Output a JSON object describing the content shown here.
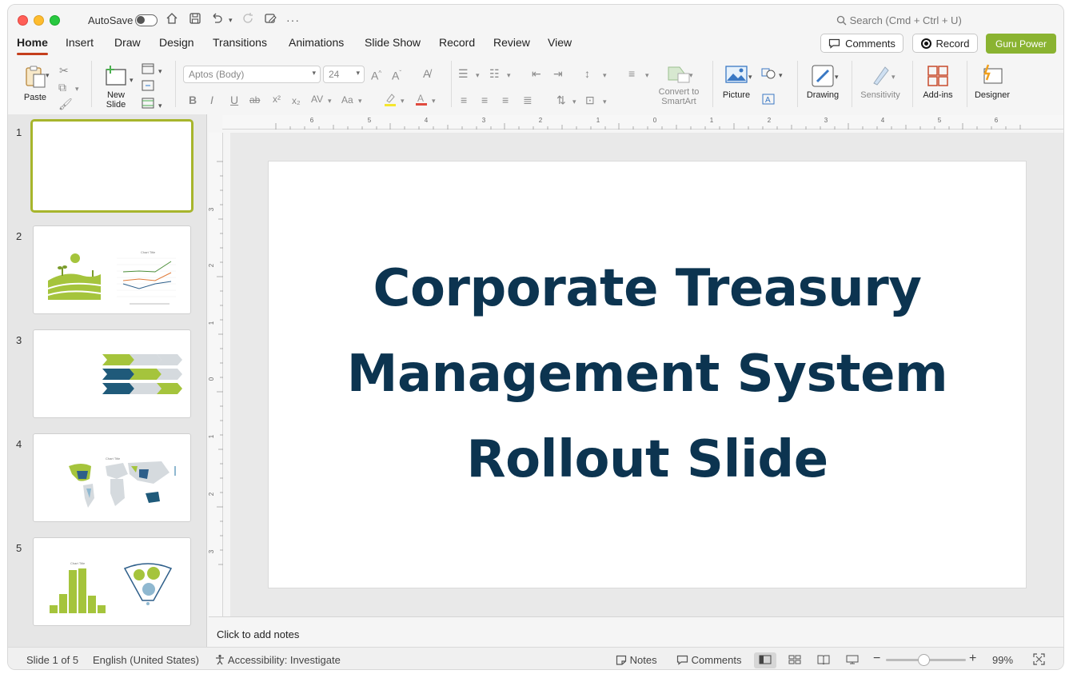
{
  "titlebar": {
    "autosave_label": "AutoSave",
    "search_placeholder": "Search (Cmd + Ctrl + U)"
  },
  "tabs": [
    "Home",
    "Insert",
    "Draw",
    "Design",
    "Transitions",
    "Animations",
    "Slide Show",
    "Record",
    "Review",
    "View"
  ],
  "header_buttons": {
    "comments": "Comments",
    "record": "Record",
    "guru": "Guru Power"
  },
  "ribbon": {
    "paste": "Paste",
    "new_slide_1": "New",
    "new_slide_2": "Slide",
    "font_name": "Aptos (Body)",
    "font_size": "24",
    "convert_1": "Convert to",
    "convert_2": "SmartArt",
    "picture": "Picture",
    "drawing": "Drawing",
    "sensitivity": "Sensitivity",
    "addins": "Add-ins",
    "designer": "Designer"
  },
  "slides": {
    "numbers": [
      "1",
      "2",
      "3",
      "4",
      "5"
    ],
    "thumb2_chart_title": "Chart Title",
    "thumb4_chart_title": "Chart Title",
    "thumb5_chart_title": "Chart Title"
  },
  "main_slide": {
    "title_line1": "Corporate Treasury",
    "title_line2": "Management System",
    "title_line3": "Rollout Slide"
  },
  "notes_placeholder": "Click to add notes",
  "statusbar": {
    "slide_count": "Slide 1 of 5",
    "language": "English (United States)",
    "accessibility": "Accessibility: Investigate",
    "notes": "Notes",
    "comments": "Comments",
    "zoom": "99%"
  },
  "colors": {
    "title": "#0c3450",
    "accent_green": "#8ab331",
    "tab_underline": "#c43e1c",
    "thumb_green": "#a5c43c",
    "thumb_navy": "#1f5a7a",
    "thumb_gray": "#d5dade"
  }
}
